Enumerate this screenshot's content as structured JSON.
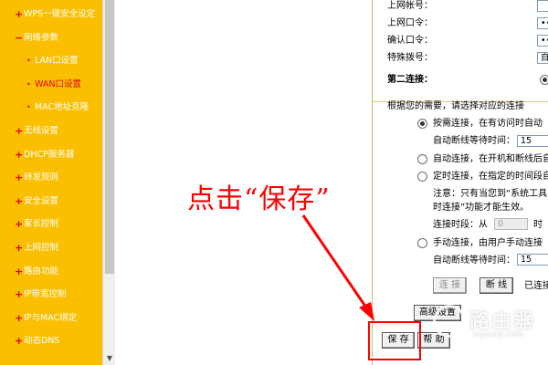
{
  "sidebar": {
    "items": [
      {
        "label": "WPS一键安全设定",
        "level": "top"
      },
      {
        "label": "网络参数",
        "level": "top-open"
      },
      {
        "label": "LAN口设置",
        "level": "sub"
      },
      {
        "label": "WAN口设置",
        "level": "sub",
        "active": true
      },
      {
        "label": "MAC地址克隆",
        "level": "sub"
      },
      {
        "label": "无线设置",
        "level": "top"
      },
      {
        "label": "DHCP服务器",
        "level": "top"
      },
      {
        "label": "转发规则",
        "level": "top"
      },
      {
        "label": "安全设置",
        "level": "top"
      },
      {
        "label": "家长控制",
        "level": "top"
      },
      {
        "label": "上网控制",
        "level": "top"
      },
      {
        "label": "路由功能",
        "level": "top"
      },
      {
        "label": "IP带宽控制",
        "level": "top"
      },
      {
        "label": "IP与MAC绑定",
        "level": "top"
      },
      {
        "label": "动态DNS",
        "level": "top"
      }
    ],
    "colors": {
      "background": "#fbbf00",
      "text": "#ffffff",
      "active": "#e60012"
    }
  },
  "form": {
    "account_label": "上网帐号：",
    "password_label": "上网口令：",
    "confirm_label": "确认口令：",
    "special_dial_label": "特殊拨号：",
    "special_dial_value": "自",
    "second_conn_label": "第二连接：",
    "hint": "根据您的需要，请选择对应的连接",
    "options": [
      {
        "label": "按需连接，在有访问时自动",
        "selected": true
      },
      {
        "label": "自动连接，在开机和断线后自",
        "selected": false
      },
      {
        "label": "定时连接，在指定的时间段自",
        "selected": false
      },
      {
        "label": "手动连接，由用户手动连接",
        "selected": false
      }
    ],
    "idle_label_1": "自动断线等待时间：",
    "idle_value_1": "15",
    "note_line1": "注意：只有当您到“系统工具",
    "note_line2": "时连接”功能才能生效。",
    "period_label": "连接时段：从",
    "period_from": "0",
    "period_unit": "时",
    "idle_label_2": "自动断线等待时间：",
    "idle_value_2": "15",
    "connect_button": "连 接",
    "disconnect_button": "断 线",
    "status_text": "已连接",
    "advanced_button": "高级设置",
    "save_button": "保 存",
    "help_button": "帮 助"
  },
  "annotation": {
    "text": "点击“保存”",
    "color": "#ff0000"
  },
  "watermark": {
    "title": "路由器",
    "url": "luyouqi.com"
  }
}
